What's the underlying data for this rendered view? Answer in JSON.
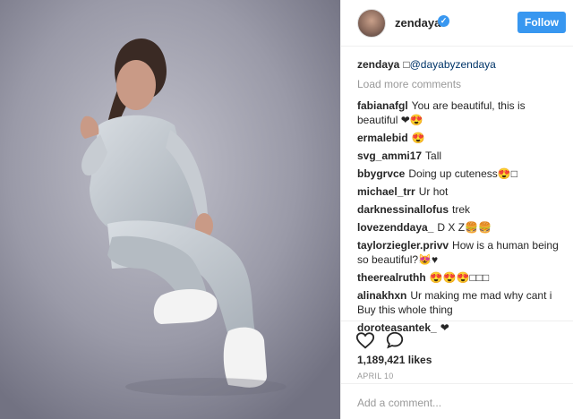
{
  "photo": {
    "alt_icon": "person-photo"
  },
  "header": {
    "username": "zendaya",
    "verified_icon": "verified-badge-icon",
    "follow_label": "Follow"
  },
  "caption": {
    "user": "zendaya",
    "text": "□",
    "mention": "@dayabyzendaya"
  },
  "load_more": "Load more comments",
  "comments": [
    {
      "user": "fabianafgl",
      "text": "You are beautiful, this is beautiful ❤😍"
    },
    {
      "user": "ermalebid",
      "text": "😍"
    },
    {
      "user": "svg_ammi17",
      "text": "Tall"
    },
    {
      "user": "bbygrvce",
      "text": "Doing up cuteness😍□"
    },
    {
      "user": "michael_trr",
      "text": "Ur hot"
    },
    {
      "user": "darknessinallofus",
      "text": "trek"
    },
    {
      "user": "lovezenddaya_",
      "text": "D X Z🍔🍔"
    },
    {
      "user": "taylorziegler.privv",
      "text": "How is a human being so beautiful?😻♥"
    },
    {
      "user": "theerealruthh",
      "text": "😍😍😍□□□"
    },
    {
      "user": "alinakhxn",
      "text": "Ur making me mad why cant i Buy this whole thing"
    },
    {
      "user": "doroteasantek_",
      "text": "❤"
    }
  ],
  "actions": {
    "like_icon": "heart-icon",
    "comment_icon": "comment-icon"
  },
  "likes": "1,189,421 likes",
  "date": "APRIL 10",
  "add_comment": {
    "placeholder": "Add a comment..."
  }
}
